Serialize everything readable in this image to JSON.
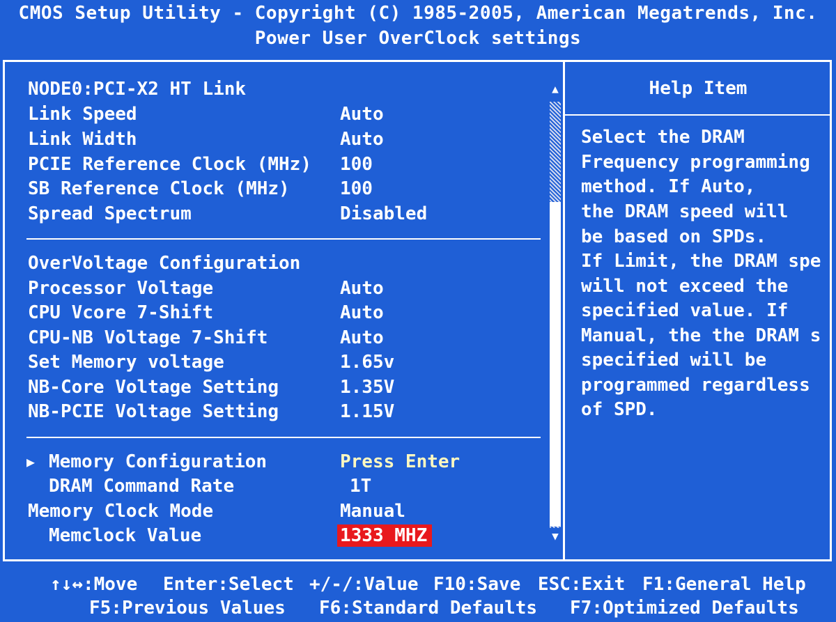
{
  "header": {
    "title": "CMOS Setup Utility - Copyright (C) 1985-2005, American Megatrends, Inc.",
    "subtitle": "Power User OverClock settings"
  },
  "colors": {
    "background": "#1f5fd6",
    "text": "#ffffff",
    "submenu_text": "#fff8c0",
    "cursor": "#e8191d"
  },
  "settings": {
    "section1": {
      "title": "NODE0:PCI-X2 HT Link",
      "items": [
        {
          "label": "Link Speed",
          "value": "Auto"
        },
        {
          "label": "Link Width",
          "value": "Auto"
        },
        {
          "label": "PCIE Reference Clock (MHz)",
          "value": "100"
        },
        {
          "label": "SB Reference Clock (MHz)",
          "value": "100"
        },
        {
          "label": "Spread Spectrum",
          "value": "Disabled"
        }
      ]
    },
    "section2": {
      "title": "OverVoltage Configuration",
      "items": [
        {
          "label": "Processor Voltage",
          "value": "Auto"
        },
        {
          "label": "CPU Vcore 7-Shift",
          "value": "Auto"
        },
        {
          "label": "CPU-NB Voltage 7-Shift",
          "value": "Auto"
        },
        {
          "label": "Set Memory voltage",
          "value": "1.65v"
        },
        {
          "label": "NB-Core Voltage Setting",
          "value": "1.35V"
        },
        {
          "label": "NB-PCIE Voltage Setting",
          "value": "1.15V"
        }
      ]
    },
    "section3": {
      "items": [
        {
          "label": "Memory Configuration",
          "value": "Press Enter",
          "submenu_arrow": "▶"
        },
        {
          "label": "DRAM Command Rate",
          "value": "1T"
        },
        {
          "label": "Memory Clock Mode",
          "value": "Manual"
        },
        {
          "label": "Memclock Value",
          "value": "1333 MHZ",
          "selected": true
        }
      ]
    }
  },
  "scrollbar": {
    "up_icon": "▲",
    "down_icon": "▼"
  },
  "help": {
    "title": "Help Item",
    "lines": [
      "Select the DRAM",
      "Frequency programming",
      "method. If Auto,",
      "the DRAM speed will",
      "be based on SPDs.",
      "If Limit, the DRAM spe",
      "will not exceed the",
      "specified value. If",
      "Manual, the the DRAM s",
      "specified will be",
      "programmed regardless",
      "of SPD."
    ]
  },
  "footer": {
    "move": "↑↓↔:Move",
    "select": "Enter:Select",
    "value": "+/-/:Value",
    "save": "F10:Save",
    "exit": "ESC:Exit",
    "help": "F1:General Help",
    "previous": "F5:Previous Values",
    "standard": "F6:Standard Defaults",
    "optimized": "F7:Optimized Defaults"
  }
}
